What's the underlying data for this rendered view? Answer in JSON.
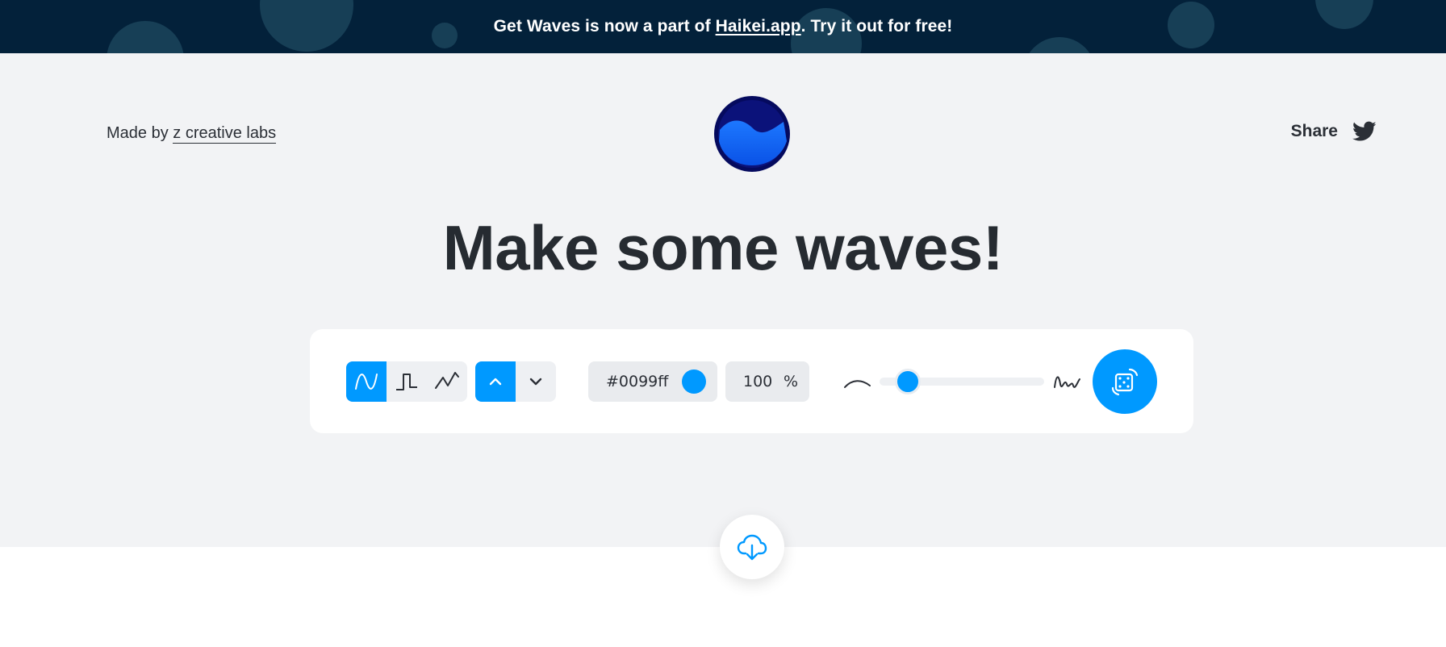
{
  "banner": {
    "prefix": "Get Waves is now a part of ",
    "link": "Haikei.app",
    "suffix": ". Try it out for free!"
  },
  "header": {
    "made_by_prefix": "Made by ",
    "made_by_link": "z creative labs",
    "share_label": "Share"
  },
  "hero": {
    "title": "Make some waves!"
  },
  "toolbar": {
    "wave_types": [
      "sine-wave-icon",
      "square-wave-icon",
      "triangle-wave-icon"
    ],
    "selected_wave_type": "sine",
    "directions": [
      "chevron-up-icon",
      "chevron-down-icon"
    ],
    "selected_direction": "up",
    "color_hex": "#0099ff",
    "opacity_value": "100",
    "opacity_unit": "%",
    "complexity_level": 0.17
  },
  "colors": {
    "accent": "#0099ff",
    "banner_bg": "#03213a",
    "hero_bg": "#f2f3f5",
    "text": "#262b31",
    "logo_dark": "#060a63"
  }
}
